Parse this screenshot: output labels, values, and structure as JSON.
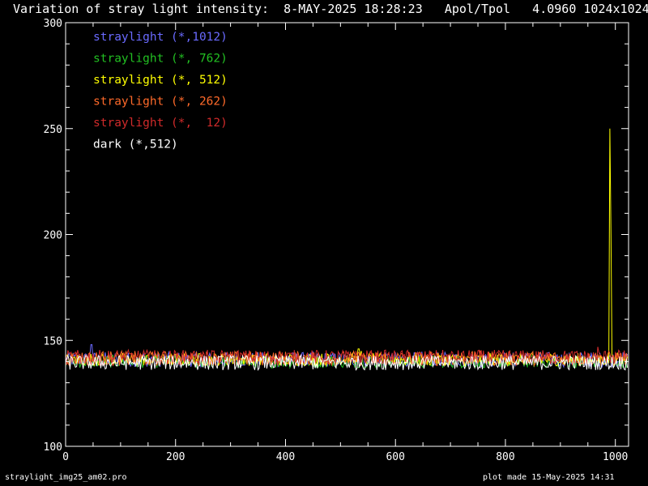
{
  "header": {
    "title": "Variation of stray light intensity:  8-MAY-2025 18:28:23   Apol/Tpol   4.0960 1024x1024"
  },
  "footer": {
    "left": "straylight_img25_am02.pro",
    "right": "plot made 15-May-2025 14:31"
  },
  "colors": {
    "background": "#000000",
    "axis": "#ffffff"
  },
  "chart_data": {
    "type": "line",
    "title": "Variation of stray light intensity:  8-MAY-2025 18:28:23   Apol/Tpol   4.0960 1024x1024",
    "xlabel": "",
    "ylabel": "",
    "xlim": [
      0,
      1024
    ],
    "ylim": [
      100,
      300
    ],
    "x_ticks": [
      0,
      200,
      400,
      600,
      800,
      1000
    ],
    "y_ticks": [
      100,
      150,
      200,
      250,
      300
    ],
    "legend_position": "top-left",
    "grid": false,
    "series": [
      {
        "name": "straylight (*,1012)",
        "color": "#6a6aff",
        "baseline": 141,
        "noise": 3.5,
        "spikes": [
          [
            47,
            148
          ]
        ]
      },
      {
        "name": "straylight (*, 762)",
        "color": "#22c022",
        "baseline": 140,
        "noise": 3.0,
        "spikes": []
      },
      {
        "name": "straylight (*, 512)",
        "color": "#ffff00",
        "baseline": 141,
        "noise": 3.0,
        "spikes": [
          [
            533,
            146
          ],
          [
            538,
            145
          ],
          [
            990,
            250
          ],
          [
            992,
            200
          ]
        ]
      },
      {
        "name": "straylight (*, 262)",
        "color": "#ff6a2a",
        "baseline": 141.5,
        "noise": 3.5,
        "spikes": []
      },
      {
        "name": "straylight (*,  12)",
        "color": "#d02a2a",
        "baseline": 142,
        "noise": 3.5,
        "spikes": [
          [
            968,
            147
          ]
        ]
      },
      {
        "name": "dark (*,512)",
        "color": "#ffffff",
        "baseline": 139.5,
        "noise": 3.5,
        "spikes": []
      }
    ]
  }
}
